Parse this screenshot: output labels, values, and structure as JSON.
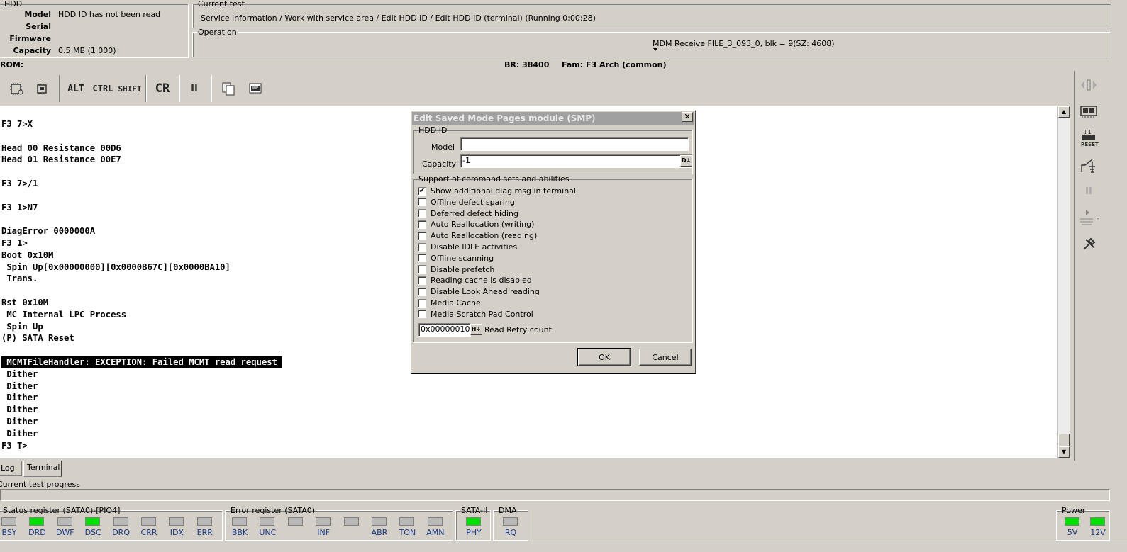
{
  "hdd": {
    "legend": "HDD",
    "model_label": "Model",
    "model_value": "HDD ID has not been read",
    "serial_label": "Serial",
    "serial_value": "",
    "firmware_label": "Firmware",
    "firmware_value": "",
    "capacity_label": "Capacity",
    "capacity_value": "0.5 MB (1 000)"
  },
  "current_test": {
    "legend": "Current test",
    "text": "Service information / Work with service area / Edit HDD ID / Edit HDD ID (terminal) (Running 0:00:28)"
  },
  "operation": {
    "legend": "Operation",
    "text": "MDM Receive FILE_3_093_0, blk = 9(SZ: 4608)"
  },
  "status_line": {
    "rom": "ROM:",
    "br": "BR: 38400",
    "fam": "Fam: F3 Arch (common)"
  },
  "toolbar": {
    "alt": "ALT",
    "ctrl": "CTRL",
    "shift": "SHIFT",
    "cr": "CR",
    "pause": "II",
    "icons": [
      "chip-open-icon",
      "chip-save-icon",
      "copy-icon",
      "terminal-settings-icon"
    ]
  },
  "terminal": {
    "lines": [
      "F3 7>X",
      "",
      "Head 00 Resistance 00D6",
      "Head 01 Resistance 00E7",
      "",
      "F3 7>/1",
      "",
      "F3 1>N7",
      "",
      "DiagError 0000000A",
      "F3 1>",
      "Boot 0x10M",
      " Spin Up[0x00000000][0x0000B67C][0x0000BA10]",
      " Trans.",
      "",
      "Rst 0x10M",
      " MC Internal LPC Process",
      " Spin Up",
      "(P) SATA Reset",
      "",
      " MCMTFileHandler: EXCEPTION: Failed MCMT read request",
      " Dither",
      " Dither",
      " Dither",
      " Dither",
      " Dither",
      " Dither",
      "F3 T>"
    ],
    "highlight_index": 20
  },
  "tabs": {
    "log": "Log",
    "terminal": "Terminal"
  },
  "progress": {
    "label": "Current test progress",
    "value": 0
  },
  "status_register": {
    "legend": "Status register (SATA0)-[PIO4]",
    "leds": [
      {
        "name": "BSY",
        "on": false
      },
      {
        "name": "DRD",
        "on": true
      },
      {
        "name": "DWF",
        "on": false
      },
      {
        "name": "DSC",
        "on": true
      },
      {
        "name": "DRQ",
        "on": false
      },
      {
        "name": "CRR",
        "on": false
      },
      {
        "name": "IDX",
        "on": false
      },
      {
        "name": "ERR",
        "on": false
      }
    ]
  },
  "error_register": {
    "legend": "Error register (SATA0)",
    "leds": [
      {
        "name": "BBK",
        "on": false
      },
      {
        "name": "UNC",
        "on": false
      },
      {
        "name": "",
        "on": false
      },
      {
        "name": "INF",
        "on": false
      },
      {
        "name": "",
        "on": false
      },
      {
        "name": "ABR",
        "on": false
      },
      {
        "name": "TON",
        "on": false
      },
      {
        "name": "AMN",
        "on": false
      }
    ]
  },
  "sata": {
    "legend": "SATA-II",
    "led": "PHY",
    "on": true
  },
  "dma": {
    "legend": "DMA",
    "led": "RQ",
    "on": false
  },
  "power": {
    "legend": "Power",
    "leds": [
      {
        "name": "5V",
        "on": true
      },
      {
        "name": "12V",
        "on": true
      }
    ]
  },
  "dialog": {
    "title": "Edit Saved Mode Pages module (SMP)",
    "close": "✕",
    "hdd_id_legend": "HDD ID",
    "model_label": "Model",
    "model_value": "",
    "capacity_label": "Capacity",
    "capacity_value": "-1",
    "capacity_btn": "D↓",
    "support_legend": "Support of command sets and abilities",
    "options": [
      {
        "label": "Show additional diag msg in terminal",
        "checked": true
      },
      {
        "label": "Offline defect sparing",
        "checked": false
      },
      {
        "label": "Deferred defect hiding",
        "checked": false
      },
      {
        "label": "Auto Reallocation (writing)",
        "checked": false
      },
      {
        "label": "Auto Reallocation (reading)",
        "checked": false
      },
      {
        "label": "Disable IDLE activities",
        "checked": false
      },
      {
        "label": "Offline scanning",
        "checked": false
      },
      {
        "label": "Disable prefetch",
        "checked": false
      },
      {
        "label": "Reading cache is disabled",
        "checked": false
      },
      {
        "label": "Disable Look Ahead reading",
        "checked": false
      },
      {
        "label": "Media Cache",
        "checked": false
      },
      {
        "label": "Media Scratch Pad Control",
        "checked": false
      }
    ],
    "retry_value": "0x00000010",
    "retry_btn": "H↓",
    "retry_label": "Read Retry count",
    "ok": "OK",
    "cancel": "Cancel"
  },
  "colors": {
    "face": "#d4d0c8",
    "led_on": "#00e000",
    "led_off": "#b8b8b8",
    "led_label": "#1a3a8a"
  }
}
